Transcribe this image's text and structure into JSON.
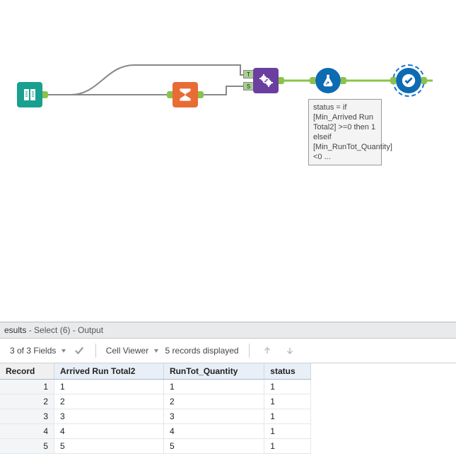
{
  "canvas": {
    "tools": {
      "input": {
        "name": "text-input-tool"
      },
      "sum": {
        "name": "summarize-tool"
      },
      "join": {
        "name": "join-tool",
        "port_top": "T",
        "port_bot": "S"
      },
      "formula": {
        "name": "formula-tool"
      },
      "select": {
        "name": "select-tool"
      }
    },
    "annotation": "status = if [Min_Arrived Run Total2] >=0 then 1\nelseif [Min_RunTot_Quantity]<0 ..."
  },
  "results": {
    "header_title": "esults",
    "header_sub": " - Select (6) - Output",
    "fields_label": "3 of 3 Fields",
    "cell_viewer_label": "Cell Viewer",
    "records_label": "5 records displayed",
    "columns": [
      "Record",
      "Arrived Run Total2",
      "RunTot_Quantity",
      "status"
    ],
    "rows": [
      {
        "rec": "1",
        "arrived": "1",
        "runtot": "1",
        "status": "1"
      },
      {
        "rec": "2",
        "arrived": "2",
        "runtot": "2",
        "status": "1"
      },
      {
        "rec": "3",
        "arrived": "3",
        "runtot": "3",
        "status": "1"
      },
      {
        "rec": "4",
        "arrived": "4",
        "runtot": "4",
        "status": "1"
      },
      {
        "rec": "5",
        "arrived": "5",
        "runtot": "5",
        "status": "1"
      }
    ]
  }
}
